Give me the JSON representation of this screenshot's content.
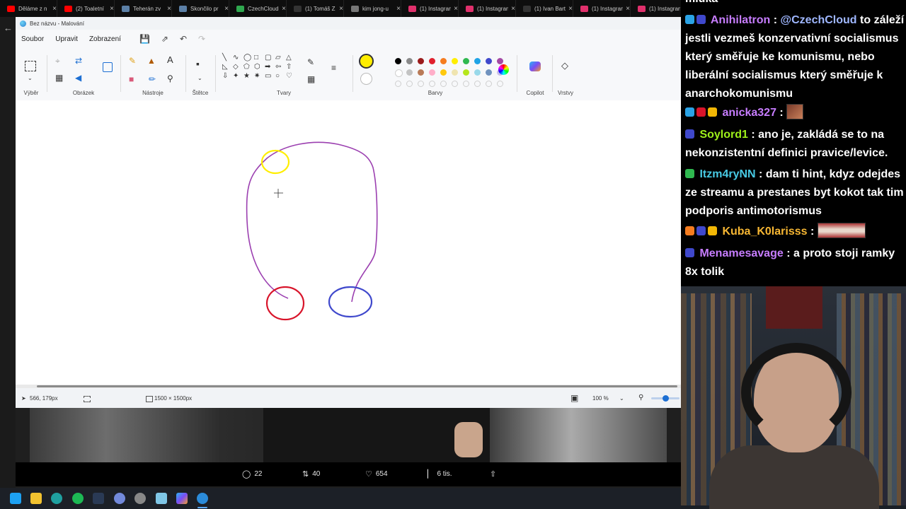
{
  "browser": {
    "tabs": [
      {
        "label": "Děláme z n",
        "color": "#ff0000"
      },
      {
        "label": "(2) Toaletní",
        "color": "#ff0000"
      },
      {
        "label": "Teherán zv",
        "color": "#5b7fa6"
      },
      {
        "label": "Skončilo pr",
        "color": "#5b7fa6"
      },
      {
        "label": "CzechCloud",
        "color": "#2fa84f"
      },
      {
        "label": "(1) Tomáš Z",
        "color": "#333333"
      },
      {
        "label": "kim jong-u",
        "color": "#777777"
      },
      {
        "label": "(1) Instagram",
        "color": "#e1306c"
      },
      {
        "label": "(1) Instagram",
        "color": "#e1306c"
      },
      {
        "label": "(1) Ivan Bart",
        "color": "#333333"
      },
      {
        "label": "(1) Instagram",
        "color": "#e1306c"
      },
      {
        "label": "(1) Instagram",
        "color": "#e1306c"
      }
    ]
  },
  "paint": {
    "window_title": "Bez názvu - Malování",
    "menu": [
      "Soubor",
      "Upravit",
      "Zobrazení"
    ],
    "groups": {
      "selection": "Výběr",
      "image": "Obrázek",
      "tools": "Nástroje",
      "brushes": "Štětce",
      "shapes": "Tvary",
      "colors": "Barvy",
      "copilot": "Copilot",
      "layers": "Vrstvy"
    },
    "active_color": "#ffee00",
    "palette_row1": [
      "#000000",
      "#8a8a8a",
      "#9b1b1b",
      "#e0202d",
      "#f57c1f",
      "#ffee00",
      "#2fb84f",
      "#1fa3e6",
      "#3f48cc",
      "#a349a4"
    ],
    "palette_row2": [
      "#ffffff",
      "#c3c3c3",
      "#b97a57",
      "#ffaec9",
      "#ffc90e",
      "#efe4b0",
      "#b5e61d",
      "#99d9ea",
      "#7092be",
      "#c8bfe7"
    ],
    "status": {
      "cursor": "566, 179px",
      "canvas_size": "1500 × 1500px",
      "zoom": "100 %",
      "zoom_level": 0.5
    }
  },
  "tweet": {
    "replies": "22",
    "retweets": "40",
    "likes": "654",
    "views": "6 tis."
  },
  "chat": {
    "partial_top": "mluka",
    "messages": [
      {
        "user": "Anihilatron",
        "color": "#c77dff",
        "text": "to záleží jestli vezmeš konzervativní socialismus který směřuje ke komunismu, nebo liberální socialismus který směřuje k anarchokomunismu",
        "mention": "@CzechCloud"
      },
      {
        "user": "anicka327",
        "color": "#c77dff",
        "text": "",
        "mention": ""
      },
      {
        "user": "Soylord1",
        "color": "#9ef01a",
        "text": "ano je, zakládá se to na nekonzistentní definici pravice/levice.",
        "mention": ""
      },
      {
        "user": "Itzm4ryNN",
        "color": "#48cae4",
        "text": "dam ti hint, kdyz odejdes ze streamu a prestanes byt kokot tak tim podporis antimotorismus",
        "mention": ""
      },
      {
        "user": "Kuba_K0larisss",
        "color": "#f7b733",
        "text": "",
        "mention": ""
      },
      {
        "user": "Menamesavage",
        "color": "#c77dff",
        "text": "a proto stoji ramky 8x tolik",
        "mention": ""
      }
    ]
  }
}
